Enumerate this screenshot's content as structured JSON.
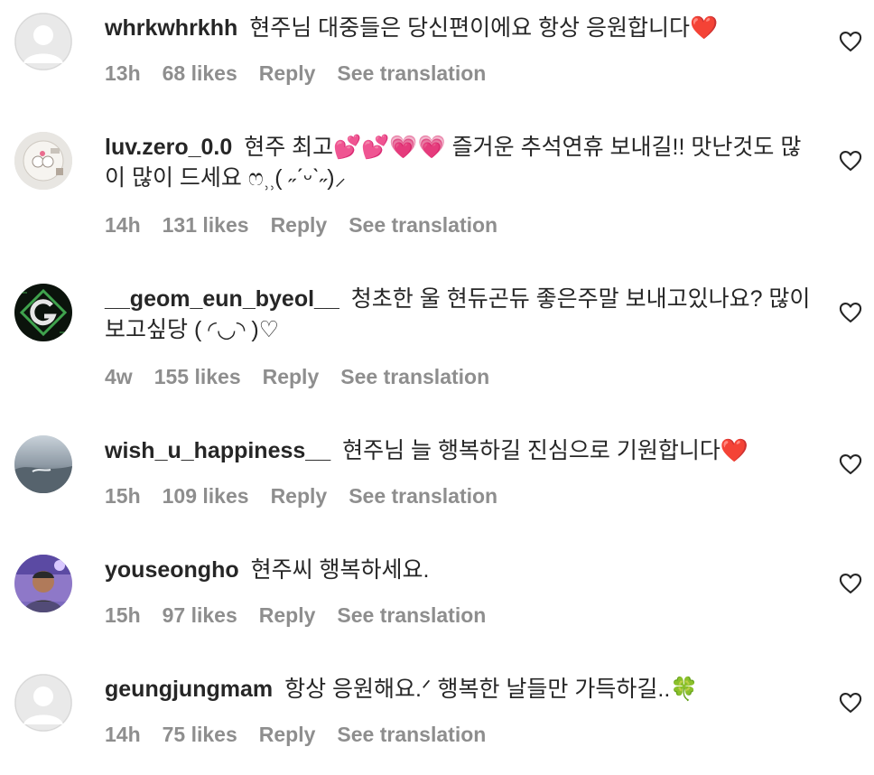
{
  "comments": [
    {
      "username": "whrkwhrkhh",
      "text": "현주님 대중들은 당신편이에요 항상 응원합니다❤️",
      "time": "13h",
      "likes": "68 likes",
      "reply": "Reply",
      "translate": "See translation",
      "avatar": "default-avatar"
    },
    {
      "username": "luv.zero_0.0",
      "text": "현주 최고💕💕💗💗 즐거운 추석연휴 보내길!! 맛난것도 많이 많이 드세요 ෆ⸒⸒( ˶ˊᵕˋ˶)⸝",
      "time": "14h",
      "likes": "131 likes",
      "reply": "Reply",
      "translate": "See translation",
      "avatar": "sticker-avatar"
    },
    {
      "username": "__geom_eun_byeol__",
      "text": "청초한 울 현듀곤듀 좋은주말 보내고있나요? 많이 보고싶당 ( ◜◡◝ )♡",
      "time": "4w",
      "likes": "155 likes",
      "reply": "Reply",
      "translate": "See translation",
      "avatar": "g-logo-avatar"
    },
    {
      "username": "wish_u_happiness__",
      "text": "현주님 늘 행복하길 진심으로 기원합니다❤️",
      "time": "15h",
      "likes": "109 likes",
      "reply": "Reply",
      "translate": "See translation",
      "avatar": "landscape-avatar"
    },
    {
      "username": "youseongho",
      "text": "현주씨 행복하세요.",
      "time": "15h",
      "likes": "97 likes",
      "reply": "Reply",
      "translate": "See translation",
      "avatar": "photo-avatar"
    },
    {
      "username": "geungjungmam",
      "text": "항상 응원해요.ᐟ 행복한 날들만 가득하길..🍀",
      "time": "14h",
      "likes": "75 likes",
      "reply": "Reply",
      "translate": "See translation",
      "avatar": "default-avatar"
    }
  ],
  "icons": {
    "like": "heart-outline-icon"
  },
  "colors": {
    "text": "#262626",
    "muted": "#8e8e8e",
    "background": "#ffffff"
  }
}
